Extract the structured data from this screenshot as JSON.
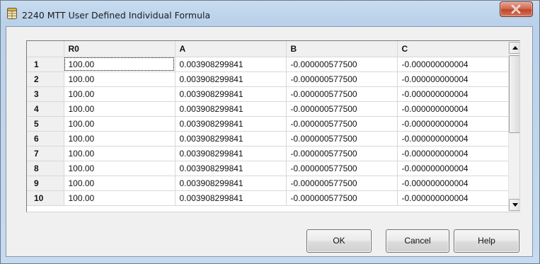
{
  "window": {
    "title": "2240 MTT User Defined Individual Formula"
  },
  "grid": {
    "columns": [
      "",
      "R0",
      "A",
      "B",
      "C"
    ],
    "rows": [
      {
        "num": "1",
        "r0": "100.00",
        "a": "0.003908299841",
        "b": "-0.000000577500",
        "c": "-0.000000000004"
      },
      {
        "num": "2",
        "r0": "100.00",
        "a": "0.003908299841",
        "b": "-0.000000577500",
        "c": "-0.000000000004"
      },
      {
        "num": "3",
        "r0": "100.00",
        "a": "0.003908299841",
        "b": "-0.000000577500",
        "c": "-0.000000000004"
      },
      {
        "num": "4",
        "r0": "100.00",
        "a": "0.003908299841",
        "b": "-0.000000577500",
        "c": "-0.000000000004"
      },
      {
        "num": "5",
        "r0": "100.00",
        "a": "0.003908299841",
        "b": "-0.000000577500",
        "c": "-0.000000000004"
      },
      {
        "num": "6",
        "r0": "100.00",
        "a": "0.003908299841",
        "b": "-0.000000577500",
        "c": "-0.000000000004"
      },
      {
        "num": "7",
        "r0": "100.00",
        "a": "0.003908299841",
        "b": "-0.000000577500",
        "c": "-0.000000000004"
      },
      {
        "num": "8",
        "r0": "100.00",
        "a": "0.003908299841",
        "b": "-0.000000577500",
        "c": "-0.000000000004"
      },
      {
        "num": "9",
        "r0": "100.00",
        "a": "0.003908299841",
        "b": "-0.000000577500",
        "c": "-0.000000000004"
      },
      {
        "num": "10",
        "r0": "100.00",
        "a": "0.003908299841",
        "b": "-0.000000577500",
        "c": "-0.000000000004"
      }
    ],
    "selected_row": 0,
    "selected_col": "r0"
  },
  "buttons": {
    "ok": "OK",
    "cancel": "Cancel",
    "help": "Help"
  },
  "icons": {
    "title": "table-icon",
    "close": "close-icon",
    "scroll_up": "scroll-up-arrow-icon",
    "scroll_down": "scroll-down-arrow-icon"
  },
  "colors": {
    "close_button": "#c9503a",
    "title_bar": "#b9d1ea",
    "dialog_background": "#f0f0f0"
  }
}
